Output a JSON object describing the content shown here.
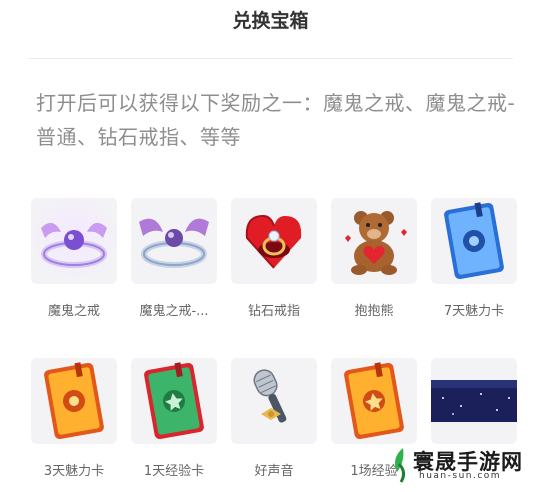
{
  "page": {
    "title": "兑换宝箱"
  },
  "description": "打开后可以获得以下奖励之一：魔鬼之戒、魔鬼之戒-普通、钻石戒指、等等",
  "rewards": [
    {
      "label": "魔鬼之戒",
      "icon": "devil-ring-icon"
    },
    {
      "label": "魔鬼之戒-...",
      "icon": "devil-ring-normal-icon"
    },
    {
      "label": "钻石戒指",
      "icon": "diamond-ring-icon"
    },
    {
      "label": "抱抱熊",
      "icon": "teddy-bear-icon"
    },
    {
      "label": "7天魅力卡",
      "icon": "charm-card-blue-icon"
    },
    {
      "label": "3天魅力卡",
      "icon": "charm-card-orange-icon"
    },
    {
      "label": "1天经验卡",
      "icon": "exp-card-green-icon"
    },
    {
      "label": "好声音",
      "icon": "microphone-icon"
    },
    {
      "label": "1场经验",
      "icon": "exp-card-orange-icon"
    },
    {
      "label": "",
      "icon": "galaxy-frame-icon"
    }
  ],
  "watermark": {
    "text": "寰晟手游网",
    "url": "huan-sun.com"
  }
}
